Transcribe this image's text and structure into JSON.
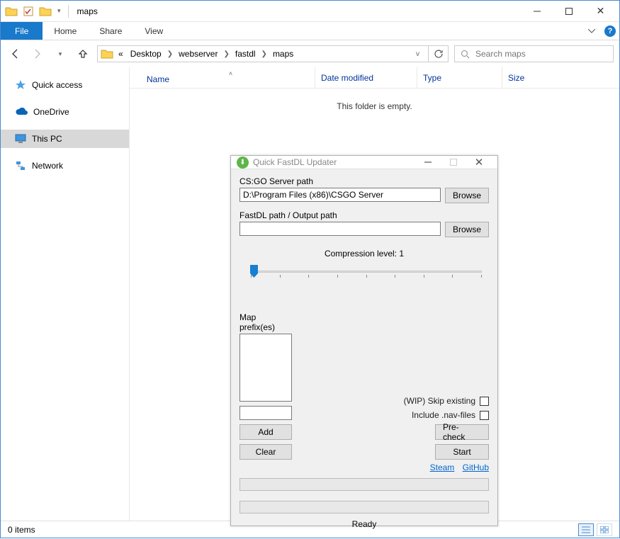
{
  "window": {
    "title": "maps",
    "min_icon": "minimize-icon",
    "max_icon": "maximize-icon",
    "close_icon": "close-icon"
  },
  "ribbon": {
    "file": "File",
    "tabs": [
      "Home",
      "Share",
      "View"
    ]
  },
  "address": {
    "prefix": "«",
    "crumbs": [
      "Desktop",
      "webserver",
      "fastdl",
      "maps"
    ],
    "search_placeholder": "Search maps"
  },
  "columns": {
    "name": "Name",
    "date": "Date modified",
    "type": "Type",
    "size": "Size"
  },
  "sidebar": {
    "items": [
      {
        "label": "Quick access",
        "icon": "star-icon"
      },
      {
        "label": "OneDrive",
        "icon": "cloud-icon"
      },
      {
        "label": "This PC",
        "icon": "pc-icon",
        "selected": true
      },
      {
        "label": "Network",
        "icon": "network-icon"
      }
    ]
  },
  "main": {
    "empty_msg": "This folder is empty."
  },
  "statusbar": {
    "items": "0 items"
  },
  "dialog": {
    "title": "Quick FastDL Updater",
    "server_path_label": "CS:GO Server path",
    "server_path_value": "D:\\Program Files (x86)\\CSGO Server",
    "browse": "Browse",
    "fastdl_label": "FastDL path / Output path",
    "fastdl_value": "",
    "compression_label": "Compression level: 1",
    "compression_value": 1,
    "compression_min": 1,
    "compression_max": 9,
    "prefix_label": "Map prefix(es)",
    "prefix_input": "",
    "add": "Add",
    "clear": "Clear",
    "skip_existing": "(WIP) Skip existing",
    "skip_existing_checked": false,
    "include_nav": "Include .nav-files",
    "include_nav_checked": false,
    "precheck": "Pre-check",
    "start": "Start",
    "link_steam": "Steam",
    "link_github": "GitHub",
    "status": "Ready"
  }
}
